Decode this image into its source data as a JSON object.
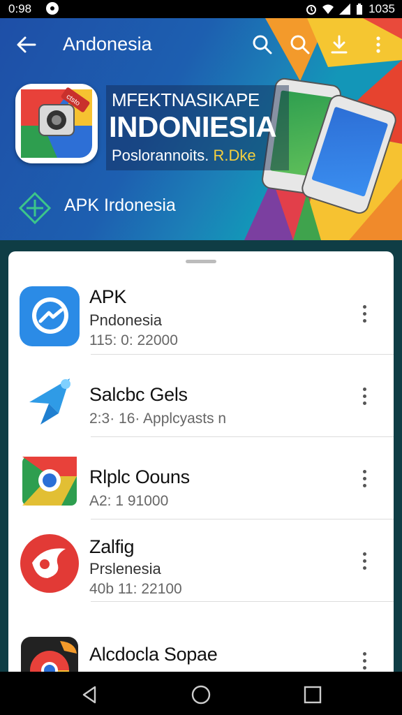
{
  "status_bar": {
    "time": "0:98",
    "clock": "1035"
  },
  "header": {
    "title": "Andonesia"
  },
  "banner": {
    "line1": "MFEKTNASIKAPE",
    "line2": "INDONIESIA",
    "line3": "Poslorannoits.",
    "line3_highlight": "R.Dke",
    "logo_badge": "ctsto",
    "apk_label": "APK Irdonesia"
  },
  "apps": [
    {
      "name": "APK",
      "sub": "Pndonesia",
      "meta": "115: 0: 22000",
      "icon": "messenger-icon"
    },
    {
      "name": "Salcbc Gels",
      "sub": "",
      "meta": "2:3· 16· Applcyasts  n",
      "icon": "paper-plane-icon"
    },
    {
      "name": "Rlplc Oouns",
      "sub": "",
      "meta": "A2: 1  91000",
      "icon": "chrome-icon"
    },
    {
      "name": "Zalfig",
      "sub": "Prslenesia",
      "meta": "40b 11: 22100",
      "icon": "red-bird-icon"
    },
    {
      "name": "Alcdocla Sopae",
      "sub": "",
      "meta": "",
      "icon": "chrome-dark-icon"
    }
  ],
  "colors": {
    "hero_blue": "#1e4fa7",
    "accent_yellow": "#f6d03d",
    "sheet_bg": "#ffffff"
  }
}
